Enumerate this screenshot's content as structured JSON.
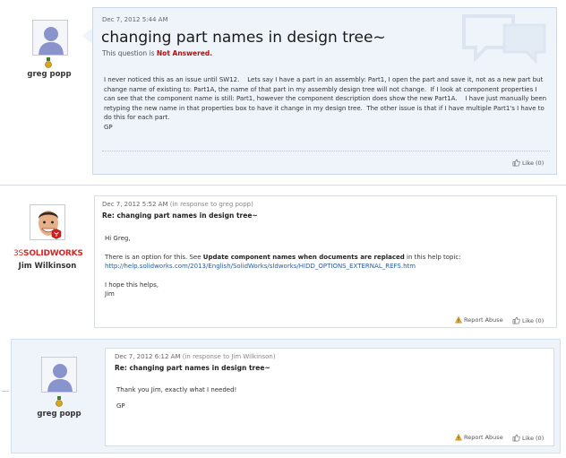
{
  "post1": {
    "author": "greg popp",
    "date": "Dec 7, 2012 5:44 AM",
    "title": "changing part names in design tree~",
    "status_prefix": "This question is",
    "status_value": "Not Answered.",
    "body": "I never noticed this as an issue until SW12.    Lets say I have a part in an assembly: Part1, I open the part and save it, not as a new part but change name of existing to: Part1A, the name of that part in my assembly design tree will not change.  If I look at component properties I can see that the component name is still: Part1, however the component description does show the new Part1A.    I have just manually been retyping the new name in that properties box to have it change in my design tree.  The other issue is that if I have multiple Part1's I have to do this for each part.",
    "signoff": "GP",
    "like": "Like (0)"
  },
  "post2": {
    "author": "Jim Wilkinson",
    "brand_prefix": "3S",
    "brand": "SOLIDWORKS",
    "date": "Dec 7, 2012 5:52 AM",
    "in_response": "(in response to greg popp)",
    "title": "Re: changing part names in design tree~",
    "greeting": "Hi Greg,",
    "line1_pre": "There is an option for this. See ",
    "line1_bold": "Update component names when documents are replaced",
    "line1_post": " in this help topic:",
    "link": "http://help.solidworks.com/2013/English/SolidWorks/sldworks/HIDD_OPTIONS_EXTERNAL_REFS.htm",
    "closing": "I hope this helps,",
    "signoff": "Jim",
    "report": "Report Abuse",
    "like": "Like (0)"
  },
  "post3": {
    "author": "greg popp",
    "date": "Dec 7, 2012 6:12 AM",
    "in_response": "(in response to Jim Wilkinson)",
    "title": "Re: changing part names in design tree~",
    "body": "Thank you Jim, exactly what I needed!",
    "signoff": "GP",
    "report": "Report Abuse",
    "like": "Like (0)"
  },
  "colors": {
    "panel_blue": "#eef4fa",
    "status_red": "#b01010",
    "brand_red": "#dd2222",
    "link_blue": "#2a5aa0"
  }
}
